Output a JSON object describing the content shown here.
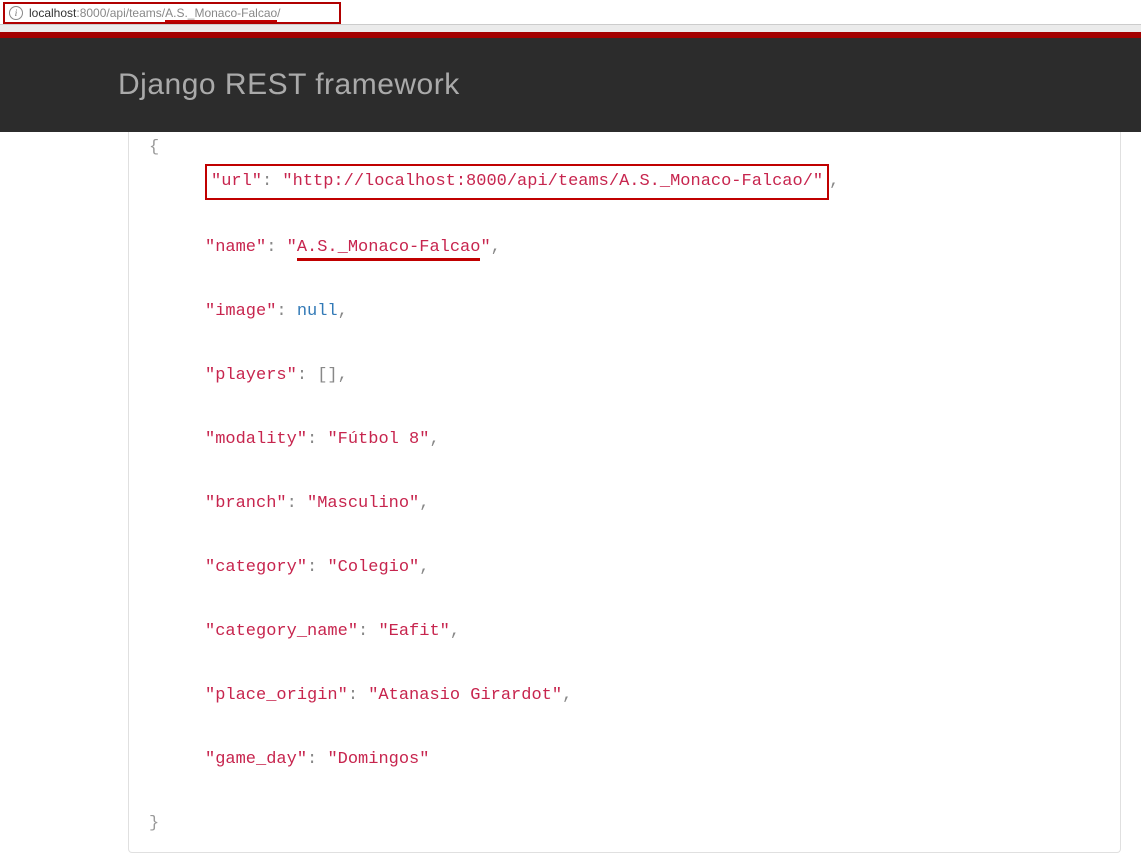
{
  "addressBar": {
    "host": "localhost",
    "port": ":8000",
    "pathPrefix": "/api/teams/",
    "pathHighlight": "A.S._Monaco-Falcao",
    "pathSuffix": "/"
  },
  "navbar": {
    "title": "Django REST framework"
  },
  "json": {
    "url_key": "\"url\"",
    "url_val": "\"http://localhost:8000/api/teams/A.S._Monaco-Falcao/\"",
    "name_key": "\"name\"",
    "name_val_open": "\"",
    "name_val_text": "A.S._Monaco-Falcao",
    "name_val_close": "\"",
    "image_key": "\"image\"",
    "image_val": "null",
    "players_key": "\"players\"",
    "players_val": "[]",
    "modality_key": "\"modality\"",
    "modality_val": "\"Fútbol 8\"",
    "branch_key": "\"branch\"",
    "branch_val": "\"Masculino\"",
    "category_key": "\"category\"",
    "category_val": "\"Colegio\"",
    "category_name_key": "\"category_name\"",
    "category_name_val": "\"Eafit\"",
    "place_origin_key": "\"place_origin\"",
    "place_origin_val": "\"Atanasio Girardot\"",
    "game_day_key": "\"game_day\"",
    "game_day_val": "\"Domingos\""
  }
}
